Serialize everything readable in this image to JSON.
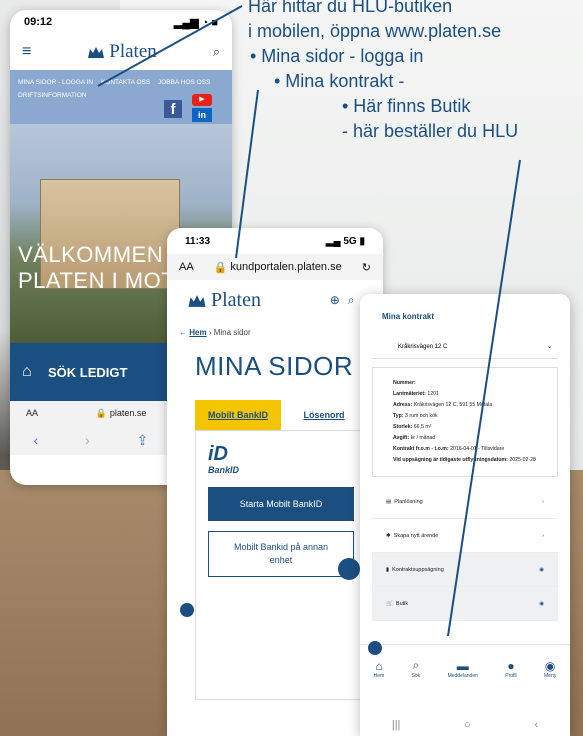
{
  "annotation": {
    "line1": "Här hittar du HLU-butiken",
    "line2": "i mobilen, öppna www.platen.se",
    "line3": "• Mina sidor - logga in",
    "line4": "• Mina kontrakt -",
    "line5": "• Här finns Butik",
    "line6": "- här beställer du HLU"
  },
  "phone1": {
    "time": "09:12",
    "logo": "Platen",
    "nav_items": [
      "MINA SIDOR - LOGGA IN",
      "KONTAKTA OSS",
      "JOBBA HOS OSS",
      "DRIFTSINFORMATION"
    ],
    "hero_line1": "VÄLKOMMEN T",
    "hero_line2": "PLATEN I MOTA",
    "cta": "SÖK LEDIGT",
    "url_prefix": "AA",
    "url": "platen.se",
    "accent": "#8ba8d0"
  },
  "phone2": {
    "time": "11:33",
    "network": "5G",
    "url_prefix": "AA",
    "url": "kundportalen.platen.se",
    "logo": "Platen",
    "crumb_home": "Hem",
    "crumb_current": "Mina sidor",
    "title": "MINA SIDOR",
    "tab_active": "Mobilt BankID",
    "tab_other": "Lösenord",
    "bankid_label": "BankID",
    "btn_start": "Starta Mobilt BankID",
    "btn_other": "Mobilt Bankid på annan enhet",
    "brand": "#1b4f82",
    "tab_color": "#f5c400"
  },
  "phone3": {
    "title": "Mina kontrakt",
    "address_short": "Kråkrisvägen 12 C",
    "nummer_label": "Nummer:",
    "lagenhet_label": "Lantmäteriet:",
    "lagenhet_value": "1201",
    "adress_label": "Adress:",
    "adress_value": "Kråkrisvägen 12 C, 591 55 Motala",
    "typ_label": "Typ:",
    "typ_value": "3 rum och kök",
    "storlek_label": "Storlek:",
    "storlek_value": "66,5 m²",
    "avgift_label": "Avgift:",
    "avgift_value": "kr / månad",
    "kontrakt_label": "Kontrakt fr.o.m - t.o.m:",
    "kontrakt_value": "2016-04-01 - Tillsvidare",
    "uppsagning_label": "Vid uppsägning är tidigaste utflyttningsdatum:",
    "uppsagning_value": "2025-02-28",
    "rows": [
      "Planlösning",
      "Skapa nytt ärende",
      "Kontraktsuppsägning",
      "Butik"
    ],
    "tabs": [
      "Hem",
      "Sök",
      "Meddelanden",
      "Profil",
      "Meny"
    ]
  }
}
